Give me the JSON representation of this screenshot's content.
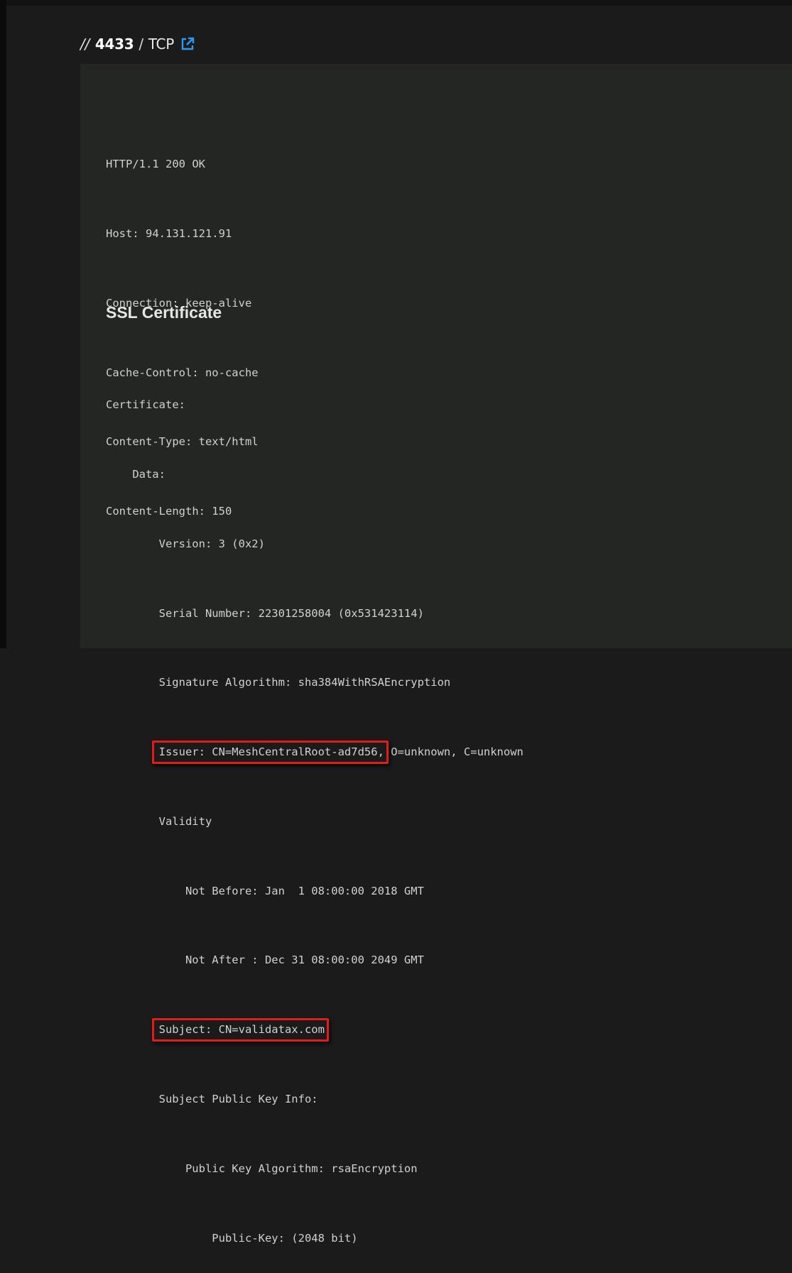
{
  "header": {
    "slashes": "//",
    "port": "4433",
    "separator": "/",
    "protocol": "TCP",
    "link_icon": "external-link-icon",
    "accent_color": "#2b9af3"
  },
  "http_banner": [
    "HTTP/1.1 200 OK",
    "Host: 94.131.121.91",
    "Connection: keep-alive",
    "Cache-Control: no-cache",
    "Content-Type: text/html",
    "Content-Length: 150"
  ],
  "ssl": {
    "title": "SSL Certificate",
    "lines": [
      {
        "indent": 0,
        "text": "Certificate:"
      },
      {
        "indent": 4,
        "text": "Data:"
      },
      {
        "indent": 8,
        "text": "Version: 3 (0x2)"
      },
      {
        "indent": 8,
        "text": "Serial Number: 22301258004 (0x531423114)"
      },
      {
        "indent": 8,
        "text": "Signature Algorithm: sha384WithRSAEncryption"
      },
      {
        "indent": 8,
        "highlight": "Issuer: CN=MeshCentralRoot-ad7d56,",
        "text": " O=unknown, C=unknown"
      },
      {
        "indent": 8,
        "text": "Validity"
      },
      {
        "indent": 12,
        "text": "Not Before: Jan  1 08:00:00 2018 GMT"
      },
      {
        "indent": 12,
        "text": "Not After : Dec 31 08:00:00 2049 GMT"
      },
      {
        "indent": 8,
        "highlight": "Subject: CN=validatax.com",
        "text": ""
      },
      {
        "indent": 8,
        "text": "Subject Public Key Info:"
      },
      {
        "indent": 12,
        "text": "Public Key Algorithm: rsaEncryption"
      },
      {
        "indent": 16,
        "text": "Public-Key: (2048 bit)"
      }
    ],
    "highlight_color": "#e41b1b"
  }
}
